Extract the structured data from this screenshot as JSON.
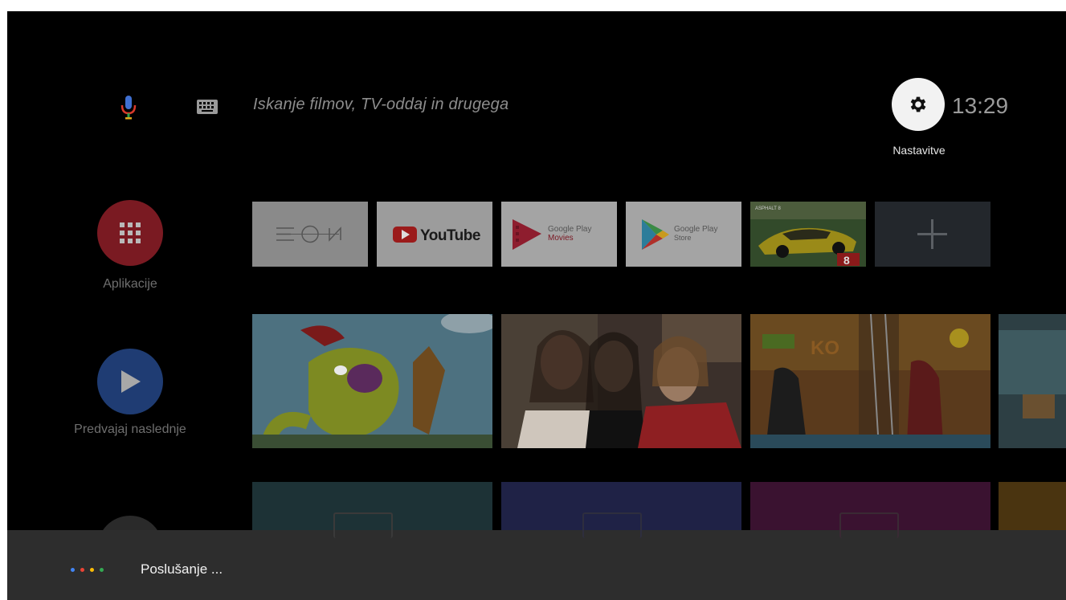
{
  "search": {
    "placeholder": "Iskanje filmov, TV-oddaj in drugega",
    "mic_icon": "mic-icon",
    "keyboard_icon": "keyboard-icon"
  },
  "header": {
    "settings_label": "Nastavitve",
    "settings_icon": "gear-icon",
    "clock": "13:29"
  },
  "nav": {
    "apps_label": "Aplikacije",
    "play_next_label": "Predvajaj naslednje"
  },
  "apps_row": [
    {
      "name": "EON",
      "label": "E  N"
    },
    {
      "name": "YouTube",
      "label": "YouTube"
    },
    {
      "name": "Google Play Movies",
      "line1": "Google Play",
      "line2": "Movies"
    },
    {
      "name": "Google Play Store",
      "line1": "Google Play",
      "line2": "Store"
    },
    {
      "name": "Asphalt game",
      "badge": "8"
    },
    {
      "name": "Add app",
      "icon": "plus-icon"
    }
  ],
  "assistant": {
    "status": "Poslušanje ...",
    "dot_colors": [
      "#4285f4",
      "#ea4335",
      "#fbbc05",
      "#34a853"
    ]
  },
  "colors": {
    "background": "#000000",
    "apps_circle": "#7a1a22",
    "play_circle": "#1f3c73",
    "assistant_bar": "#2d2d2d"
  }
}
